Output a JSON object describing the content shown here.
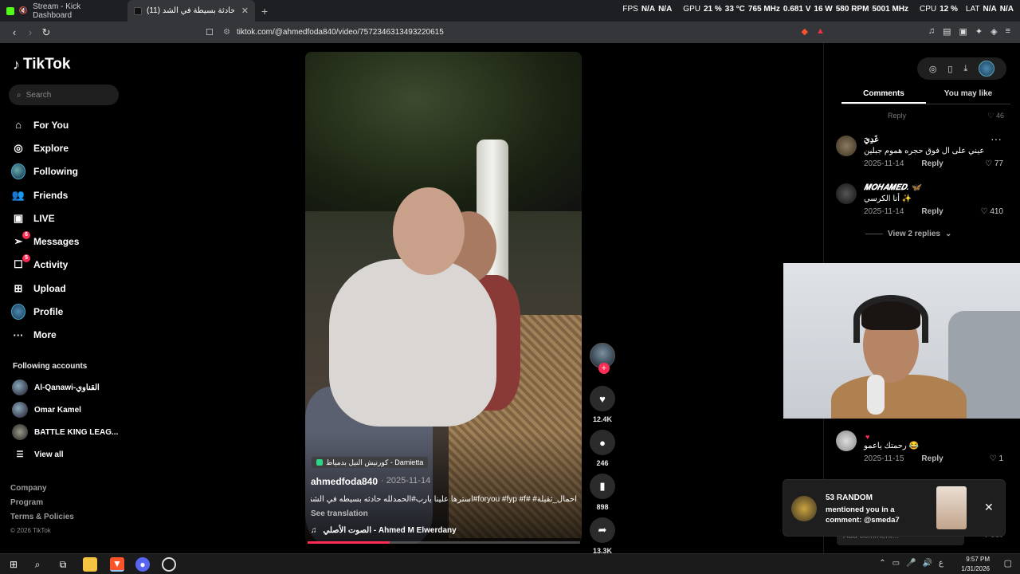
{
  "browser": {
    "tabs": [
      {
        "label": "Stream - Kick Dashboard",
        "favicon_color": "#53fc18",
        "active": false
      },
      {
        "label": "(11) الحمدلله حادثة بسيطة في الشد",
        "favicon_color": "#000000",
        "active": true
      }
    ],
    "new_tab": "+",
    "url": "tiktok.com/@ahmedfoda840/video/7572346313493220615",
    "overlay": {
      "fps_label": "FPS",
      "fps1": "N/A",
      "fps2": "N/A",
      "gpu_label": "GPU",
      "gpu_load": "21 %",
      "gpu_temp": "33 °C",
      "gpu_clock": "765 MHz",
      "gpu_volt": "0.681 V",
      "gpu_power": "16 W",
      "gpu_fan": "580 RPM",
      "gpu_mem": "5001 MHz",
      "cpu_label": "CPU",
      "cpu_load": "12 %",
      "lat_label": "LAT",
      "lat1": "N/A",
      "lat2": "N/A"
    }
  },
  "sidebar": {
    "logo": "TikTok",
    "search_placeholder": "Search",
    "nav": [
      {
        "label": "For You",
        "icon": "home-icon"
      },
      {
        "label": "Explore",
        "icon": "compass-icon"
      },
      {
        "label": "Following",
        "icon": "avatar-icon"
      },
      {
        "label": "Friends",
        "icon": "friends-icon"
      },
      {
        "label": "LIVE",
        "icon": "live-icon"
      },
      {
        "label": "Messages",
        "icon": "messages-icon",
        "badge": "6"
      },
      {
        "label": "Activity",
        "icon": "activity-icon",
        "badge": "5"
      },
      {
        "label": "Upload",
        "icon": "upload-icon"
      },
      {
        "label": "Profile",
        "icon": "profile-icon"
      },
      {
        "label": "More",
        "icon": "more-icon"
      }
    ],
    "following_title": "Following accounts",
    "following": [
      {
        "name": "Al-Qanawi-القناوي"
      },
      {
        "name": "Omar Kamel"
      },
      {
        "name": "BATTLE KING LEAG..."
      }
    ],
    "view_all": "View all",
    "footer": [
      "Company",
      "Program",
      "Terms & Policies"
    ],
    "copyright": "© 2026 TikTok"
  },
  "video": {
    "location": "كورنيش النيل بدمياط - Damietta",
    "author": "ahmedfoda840",
    "date": "· 2025-11-14",
    "caption": "احمال_ثقيلة# #foryou #fyp #f#استرها علينا يارب#الحمدلله حادثه بسيطه في الشنيشه...",
    "see_translation": "See translation",
    "music": "الصوت الأصلي - Ahmed M Elwerdany",
    "progress": 0.3
  },
  "actions": {
    "likes": "12.4K",
    "comments": "246",
    "saves": "898",
    "shares": "13.3K"
  },
  "right": {
    "tabs": [
      "Comments",
      "You may like"
    ],
    "partial_reply": "Reply",
    "partial_likes": "46",
    "comments": [
      {
        "name": "غَدِيَ",
        "text": "عيني على ال فوق حجره هموم جبلين",
        "date": "2025-11-14",
        "reply": "Reply",
        "likes": "77"
      },
      {
        "name": "𝑴𝑶𝑯𝑨𝑴𝑬𝑫. 🦋",
        "text": "أنا الكرسي ✨",
        "date": "2025-11-14",
        "reply": "Reply",
        "likes": "410"
      },
      {
        "name": "",
        "text": "رحمتك ياعمو 😂",
        "date": "2025-11-15",
        "reply": "Reply",
        "likes": "1"
      }
    ],
    "view_replies": "View 2 replies",
    "notification": {
      "title": "53 RANDOM",
      "text": "mentioned you in a comment: @smeda7"
    },
    "comment_placeholder": "Add comment...",
    "post": "Post"
  },
  "taskbar": {
    "time": "9:57 PM",
    "date": "1/31/2026",
    "lang": "ع"
  }
}
